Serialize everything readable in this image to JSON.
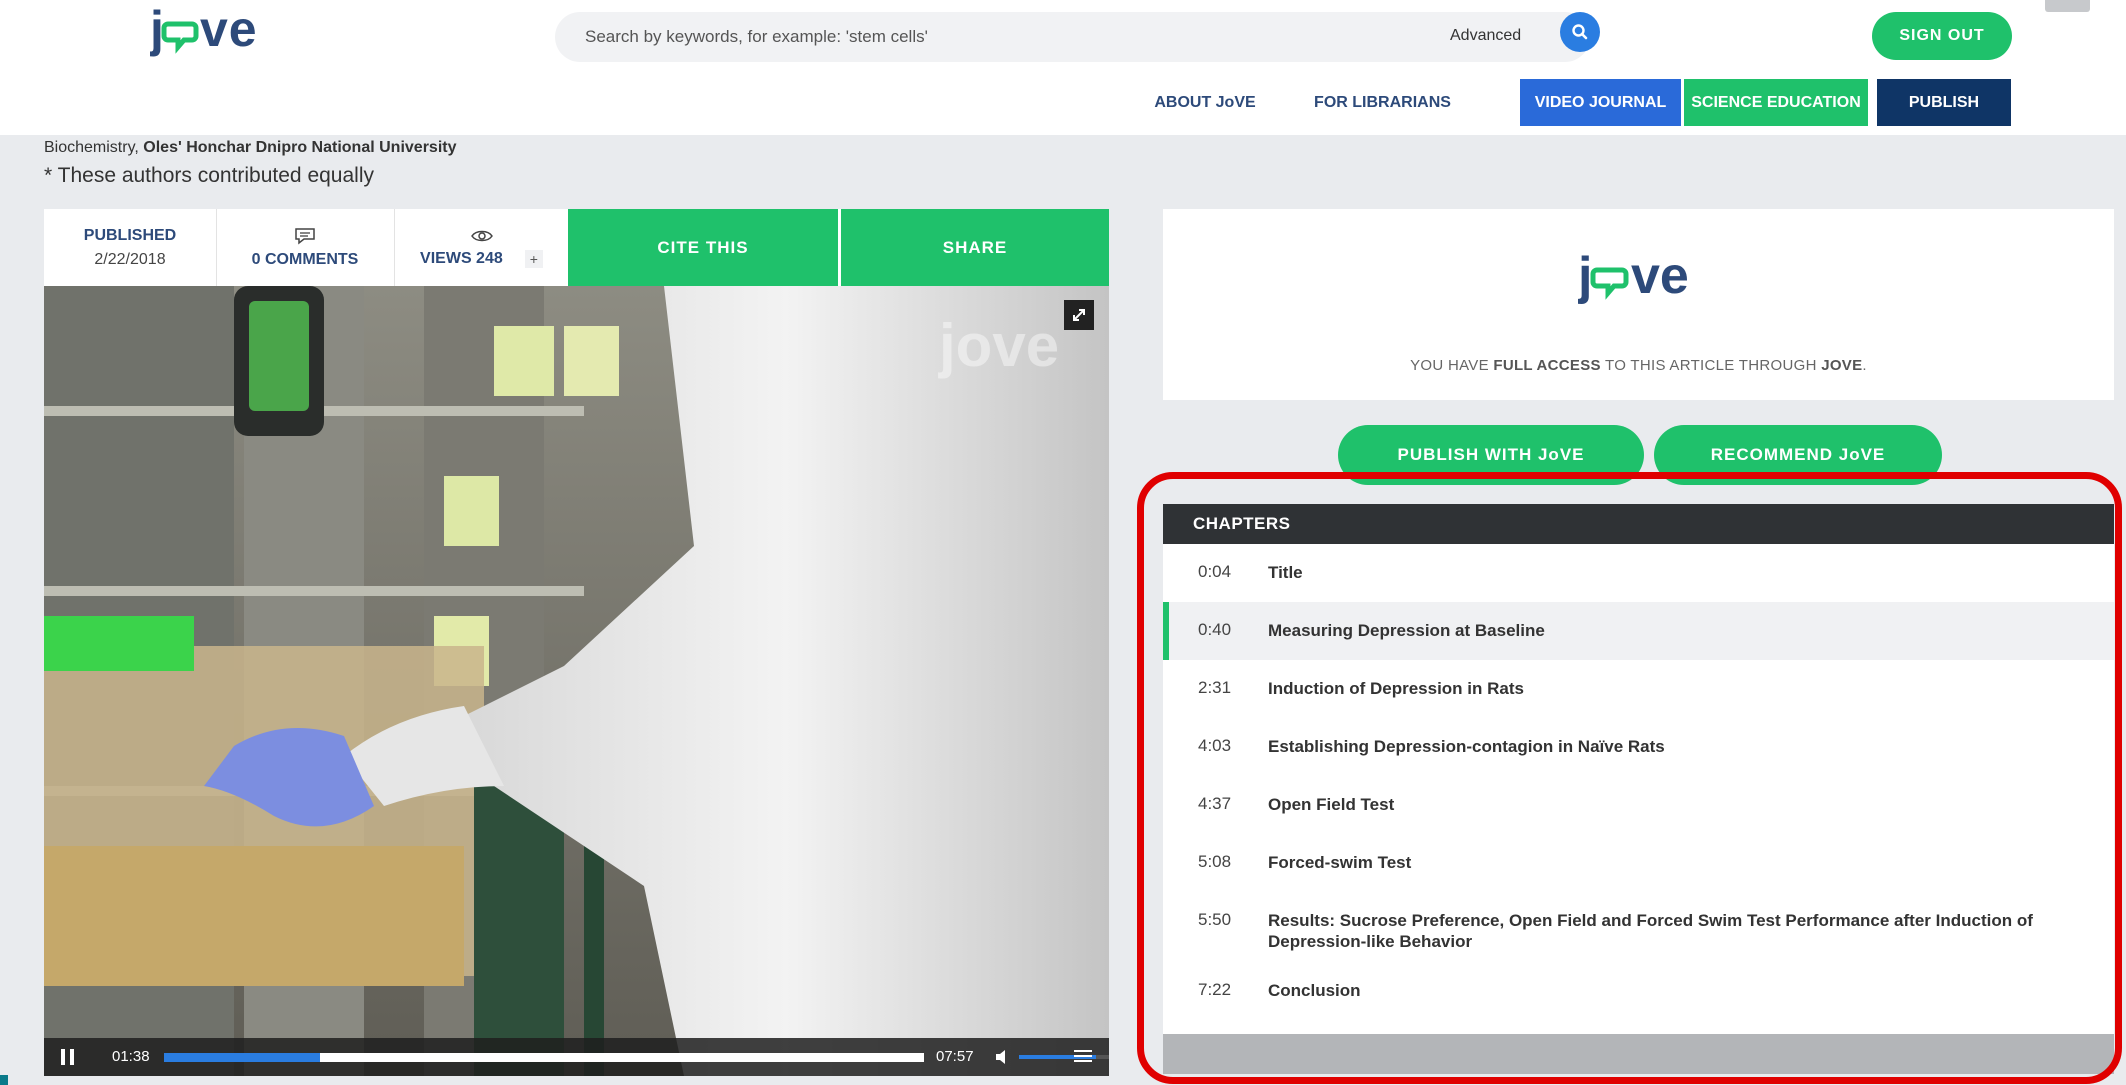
{
  "header": {
    "search_placeholder": "Search by keywords, for example: 'stem cells'",
    "advanced_label": "Advanced",
    "sign_out_label": "SIGN OUT"
  },
  "nav": {
    "about": "ABOUT JoVE",
    "librarians": "FOR LIBRARIANS",
    "video_journal": "VIDEO JOURNAL",
    "science_education": "SCIENCE EDUCATION",
    "publish": "PUBLISH"
  },
  "article": {
    "affiliation_prefix": "Biochemistry, ",
    "affiliation_university": "Oles' Honchar Dnipro National University",
    "equal_note": "* These authors contributed equally",
    "published_label": "PUBLISHED",
    "published_date": "2/22/2018",
    "comments_label": "0 COMMENTS",
    "views_label": "VIEWS 248",
    "views_plus": "+",
    "cite_label": "CITE THIS",
    "share_label": "SHARE"
  },
  "player": {
    "current_time": "01:38",
    "duration": "07:57",
    "progress_fraction": 0.205,
    "buffered_fraction": 1.0,
    "volume_fraction": 0.85
  },
  "access": {
    "text_prefix": "YOU HAVE ",
    "text_bold": "FULL ACCESS",
    "text_middle": " TO THIS ARTICLE THROUGH ",
    "text_brand": "JOVE",
    "text_suffix": "."
  },
  "buttons": {
    "publish_with": "PUBLISH WITH JoVE",
    "recommend": "RECOMMEND JoVE"
  },
  "chapters": {
    "title": "CHAPTERS",
    "items": [
      {
        "time": "0:04",
        "name": "Title"
      },
      {
        "time": "0:40",
        "name": "Measuring Depression at Baseline"
      },
      {
        "time": "2:31",
        "name": "Induction of Depression in Rats"
      },
      {
        "time": "4:03",
        "name": "Establishing Depression-contagion in Naïve Rats"
      },
      {
        "time": "4:37",
        "name": "Open Field Test"
      },
      {
        "time": "5:08",
        "name": "Forced-swim Test"
      },
      {
        "time": "5:50",
        "name": "Results: Sucrose Preference, Open Field and Forced Swim Test Performance after Induction of Depression-like Behavior"
      },
      {
        "time": "7:22",
        "name": "Conclusion"
      }
    ]
  },
  "colors": {
    "brand_green": "#1fc16b",
    "brand_blue": "#2a7de1",
    "brand_navy": "#0f3566",
    "highlight_red": "#e00000"
  }
}
